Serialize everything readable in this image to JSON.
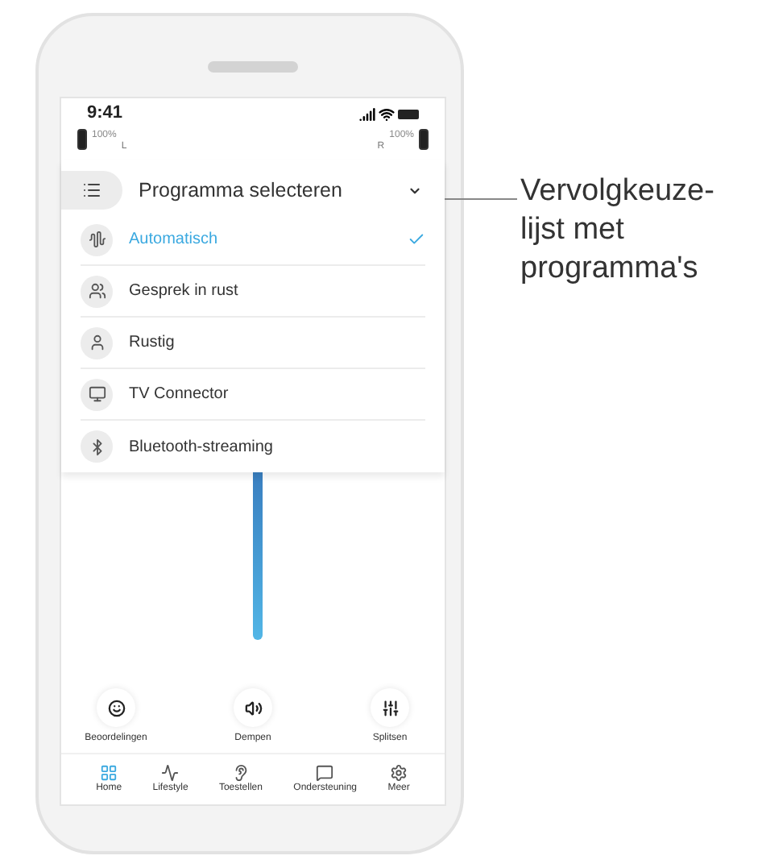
{
  "status_bar": {
    "time": "9:41"
  },
  "hearing_aids": [
    {
      "battery": "100%",
      "side": "L"
    },
    {
      "battery": "100%",
      "side": "R"
    }
  ],
  "program_menu": {
    "title": "Programma selecteren",
    "expanded": true,
    "items": [
      {
        "kind": "auto",
        "label": "Automatisch",
        "selected": true
      },
      {
        "kind": "conversation",
        "label": "Gesprek in rust",
        "selected": false
      },
      {
        "kind": "quiet",
        "label": "Rustig",
        "selected": false
      },
      {
        "kind": "tv",
        "label": "TV Connector",
        "selected": false
      },
      {
        "kind": "bluetooth",
        "label": "Bluetooth-streaming",
        "selected": false
      }
    ]
  },
  "actions": [
    {
      "kind": "feedback",
      "label": "Beoordelingen"
    },
    {
      "kind": "mute",
      "label": "Dempen"
    },
    {
      "kind": "split",
      "label": "Splitsen"
    }
  ],
  "tab_bar": [
    {
      "kind": "home",
      "label": "Home",
      "selected": true
    },
    {
      "kind": "lifestyle",
      "label": "Lifestyle",
      "selected": false
    },
    {
      "kind": "devices",
      "label": "Toestellen",
      "selected": false
    },
    {
      "kind": "support",
      "label": "Ondersteuning",
      "selected": false
    },
    {
      "kind": "more",
      "label": "Meer",
      "selected": false
    }
  ],
  "callout": {
    "text": "Vervolgkeuze-lijst met programma's"
  }
}
